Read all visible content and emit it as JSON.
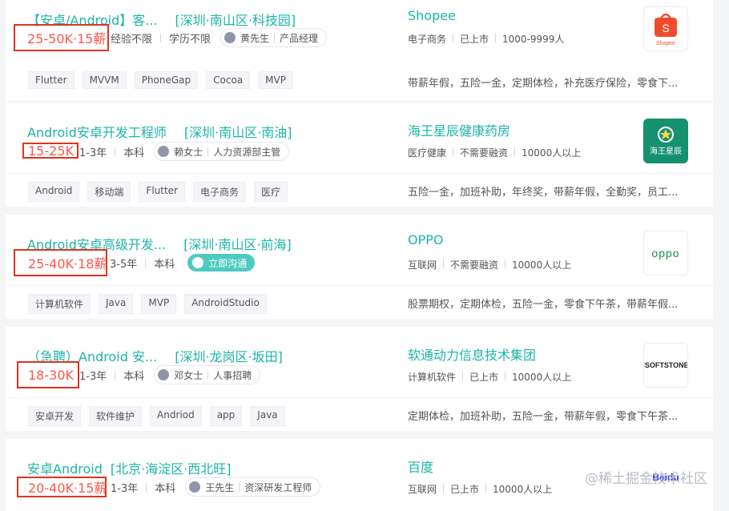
{
  "jobs": [
    {
      "title": "【安卓/Android】客...",
      "location": "[深圳·南山区·科技园]",
      "salary": "25-50K·15薪",
      "experience": "经验不限",
      "education": "学历不限",
      "contact_name": "黄先生",
      "contact_role": "产品经理",
      "chat_label": "",
      "company": "Shopee",
      "industry": "电子商务",
      "funding": "已上市",
      "size": "1000-9999人",
      "logo_text": "Shopee",
      "logo_color": "#ee4d2d",
      "tags": [
        "Flutter",
        "MVVM",
        "PhoneGap",
        "Cocoa",
        "MVP"
      ],
      "welfare": "带薪年假，五险一金，定期体检，补充医疗保险，零食下..."
    },
    {
      "title": "Android安卓开发工程师",
      "location": "[深圳·南山区·南油]",
      "salary": "15-25K",
      "experience": "1-3年",
      "education": "本科",
      "contact_name": "赖女士",
      "contact_role": "人力资源部主管",
      "chat_label": "",
      "company": "海王星辰健康药房",
      "industry": "医疗健康",
      "funding": "不需要融资",
      "size": "10000人以上",
      "logo_text": "海王星辰",
      "logo_color": "#15916f",
      "tags": [
        "Android",
        "移动端",
        "Flutter",
        "电子商务",
        "医疗"
      ],
      "welfare": "五险一金，加班补助，年终奖，带薪年假，全勤奖，员工..."
    },
    {
      "title": "Android安卓高级开发...",
      "location": "[深圳·南山区·前海]",
      "salary": "25-40K·18薪",
      "experience": "3-5年",
      "education": "本科",
      "contact_name": "",
      "contact_role": "",
      "chat_label": "立即沟通",
      "company": "OPPO",
      "industry": "互联网",
      "funding": "不需要融资",
      "size": "10000人以上",
      "logo_text": "oppo",
      "logo_color": "#1d8f43",
      "tags": [
        "计算机软件",
        "Java",
        "MVP",
        "AndroidStudio"
      ],
      "welfare": "股票期权，定期体检，五险一金，零食下午茶，带薪年假..."
    },
    {
      "title": "（急聘）Android 安...",
      "location": "[深圳·龙岗区·坂田]",
      "salary": "18-30K",
      "experience": "1-3年",
      "education": "本科",
      "contact_name": "邓女士",
      "contact_role": "人事招聘",
      "chat_label": "",
      "company": "软通动力信息技术集团",
      "industry": "计算机软件",
      "funding": "已上市",
      "size": "10000人以上",
      "logo_text": "iSOFTSTONE",
      "logo_color": "#222222",
      "tags": [
        "安卓开发",
        "软件维护",
        "Andriod",
        "app",
        "Java"
      ],
      "welfare": "定期体检，加班补助，五险一金，带薪年假，零食下午茶..."
    },
    {
      "title": "安卓Android",
      "location": "[北京·海淀区·西北旺]",
      "salary": "20-40K·15薪",
      "experience": "1-3年",
      "education": "本科",
      "contact_name": "王先生",
      "contact_role": "资深研发工程师",
      "chat_label": "",
      "company": "百度",
      "industry": "互联网",
      "funding": "已上市",
      "size": "10000人以上",
      "logo_text": "Baidu",
      "logo_color": "#2932e1",
      "tags": [],
      "welfare": ""
    }
  ],
  "watermark": "@稀土掘金技术社区"
}
